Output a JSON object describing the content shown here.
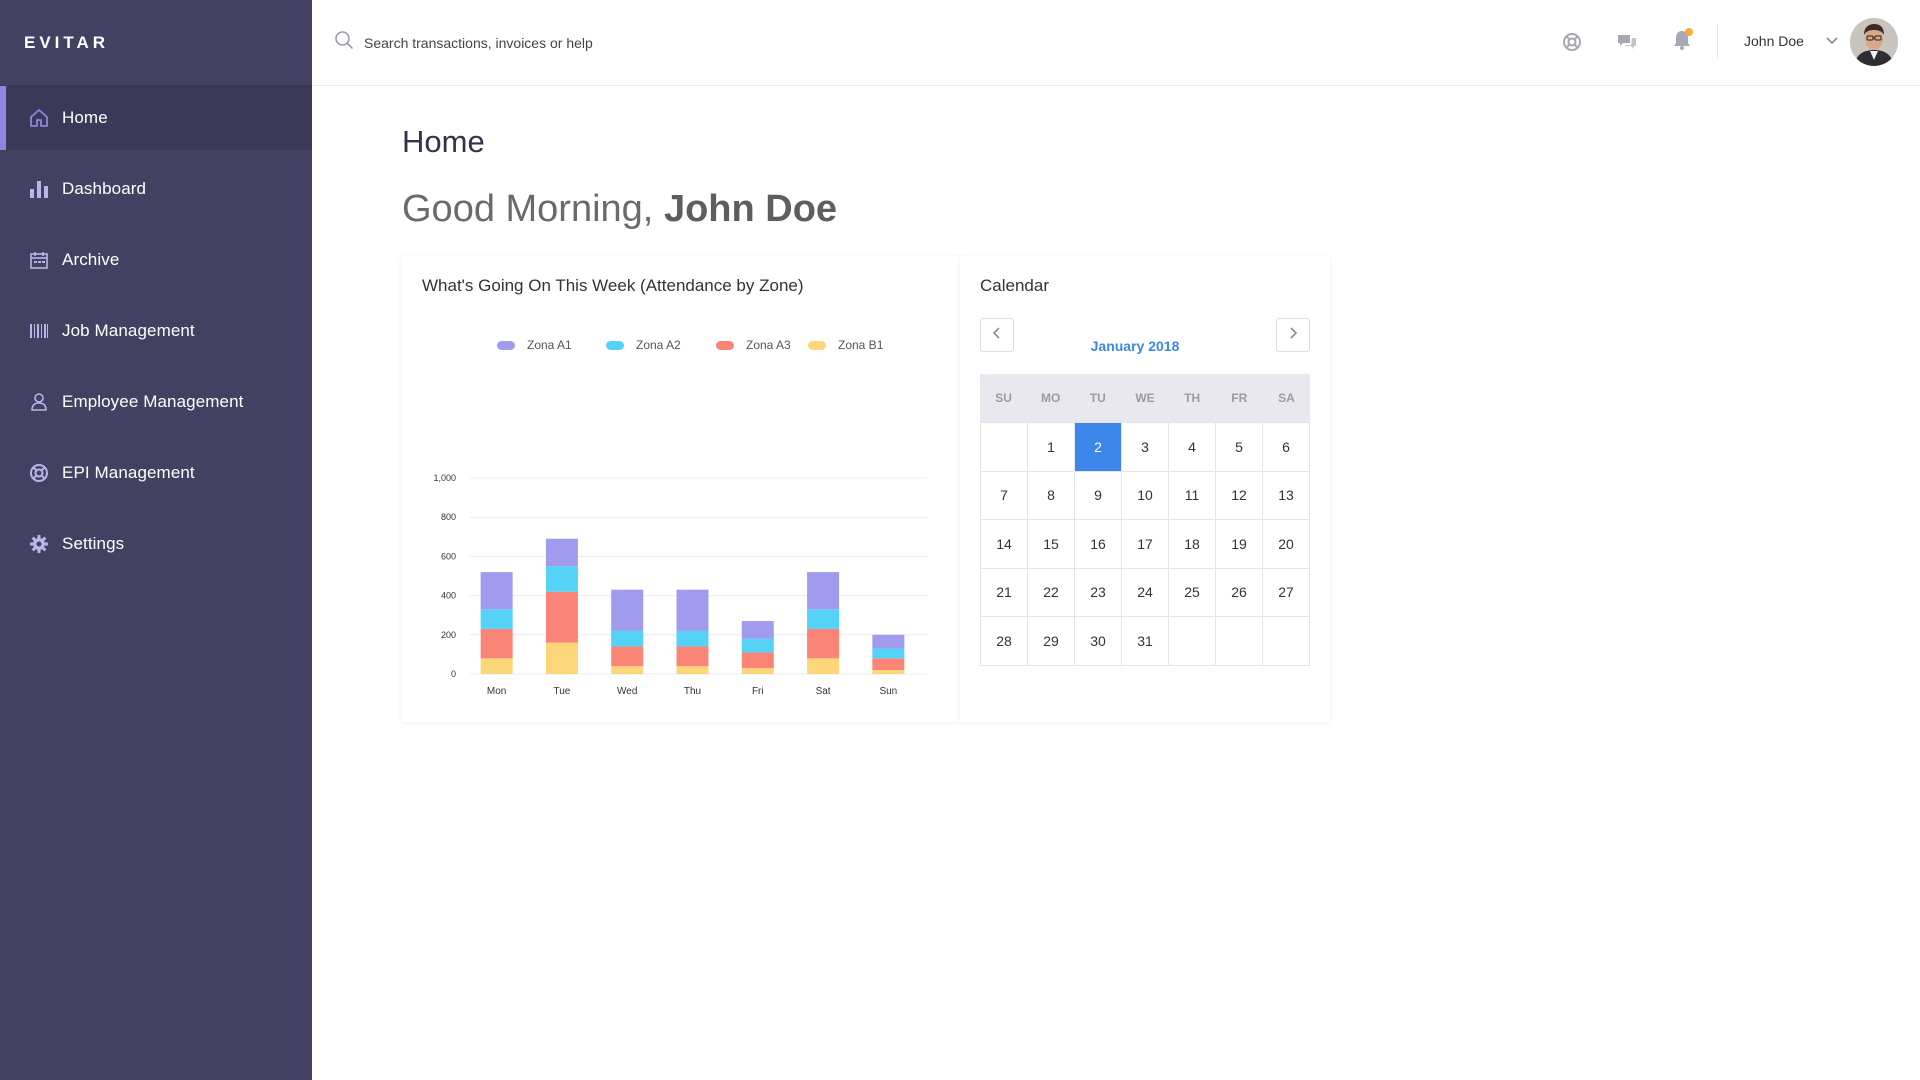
{
  "brand": "EVITAR",
  "sidebar": {
    "items": [
      {
        "label": "Home",
        "icon": "home-icon",
        "active": true
      },
      {
        "label": "Dashboard",
        "icon": "bar-chart-icon",
        "active": false
      },
      {
        "label": "Archive",
        "icon": "calendar-icon",
        "active": false
      },
      {
        "label": "Job Management",
        "icon": "barcode-icon",
        "active": false
      },
      {
        "label": "Employee Management",
        "icon": "user-icon",
        "active": false
      },
      {
        "label": "EPI Management",
        "icon": "lifebuoy-icon",
        "active": false
      },
      {
        "label": "Settings",
        "icon": "gear-icon",
        "active": false
      }
    ]
  },
  "search": {
    "placeholder": "Search transactions, invoices or help"
  },
  "topbar": {
    "icons": [
      "lifebuoy-icon",
      "chat-icon",
      "bell-icon"
    ],
    "notification_dot": true,
    "user_name": "John Doe"
  },
  "main": {
    "page_title": "Home",
    "greeting_prefix": "Good Morning,",
    "greeting_name": "John Doe"
  },
  "chart_card": {
    "title": "What's Going On This Week (Attendance by Zone)"
  },
  "chart_data": {
    "type": "bar",
    "stacked": true,
    "title": "",
    "xlabel": "",
    "ylabel": "",
    "categories": [
      "Mon",
      "Tue",
      "Wed",
      "Thu",
      "Fri",
      "Sat",
      "Sun"
    ],
    "series": [
      {
        "name": "Zona B1",
        "color": "#fdd67a",
        "values": [
          80,
          160,
          40,
          40,
          30,
          80,
          20
        ]
      },
      {
        "name": "Zona A3",
        "color": "#fa8576",
        "values": [
          150,
          260,
          100,
          100,
          80,
          150,
          60
        ]
      },
      {
        "name": "Zona A2",
        "color": "#55d3f7",
        "values": [
          100,
          130,
          80,
          80,
          70,
          100,
          50
        ]
      },
      {
        "name": "Zona A1",
        "color": "#a19bf0",
        "values": [
          190,
          140,
          210,
          210,
          90,
          190,
          70
        ]
      }
    ],
    "legend_order": [
      "Zona A1",
      "Zona A2",
      "Zona A3",
      "Zona B1"
    ],
    "yticks": [
      0,
      200,
      400,
      600,
      800,
      1000
    ],
    "ytick_labels": [
      "0",
      "200",
      "400",
      "600",
      "800",
      "1,000"
    ],
    "ylim": [
      0,
      1000
    ],
    "grid": true,
    "legend_position": "top"
  },
  "calendar": {
    "title": "Calendar",
    "month_label": "January 2018",
    "weekdays": [
      "SU",
      "MO",
      "TU",
      "WE",
      "TH",
      "FR",
      "SA"
    ],
    "days": [
      "",
      "1",
      "2",
      "3",
      "4",
      "5",
      "6",
      "7",
      "8",
      "9",
      "10",
      "11",
      "12",
      "13",
      "14",
      "15",
      "16",
      "17",
      "18",
      "19",
      "20",
      "21",
      "22",
      "23",
      "24",
      "25",
      "26",
      "27",
      "28",
      "29",
      "30",
      "31",
      "",
      "",
      ""
    ],
    "selected_day": "2",
    "accent_color": "#3b86e8"
  }
}
